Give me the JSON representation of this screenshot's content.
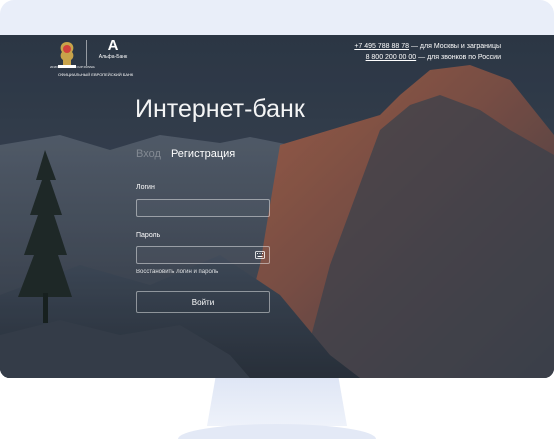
{
  "brand": {
    "partner_text": "2018 FIFA WORLD CUP RUSSIA",
    "bank_glyph": "А",
    "bank_name": "Альфа-Банк",
    "tagline": "ОФИЦИАЛЬНЫЙ ЕВРОПЕЙСКИЙ БАНК"
  },
  "contacts": [
    {
      "number": "+7 495 788 88 78",
      "note": " — для Москвы и заграницы"
    },
    {
      "number": "8 800 200 00 00",
      "note": " — для звонков по России"
    }
  ],
  "page_title": "Интернет-банк",
  "tabs": [
    {
      "label": "Вход",
      "active": false
    },
    {
      "label": "Регистрация",
      "active": true
    }
  ],
  "form": {
    "login_label": "Логин",
    "login_value": "",
    "password_label": "Пароль",
    "password_value": "",
    "recover_link": "Восстановить логин и пароль",
    "submit_label": "Войти"
  },
  "icons": {
    "keyboard": "keyboard-icon",
    "emblem": "world-cup-emblem-icon"
  },
  "colors": {
    "frame": "#e9eef9",
    "sky": "#33404f",
    "cliff_lit": "#b06b4e",
    "cliff_shadow": "#4a4e57"
  }
}
